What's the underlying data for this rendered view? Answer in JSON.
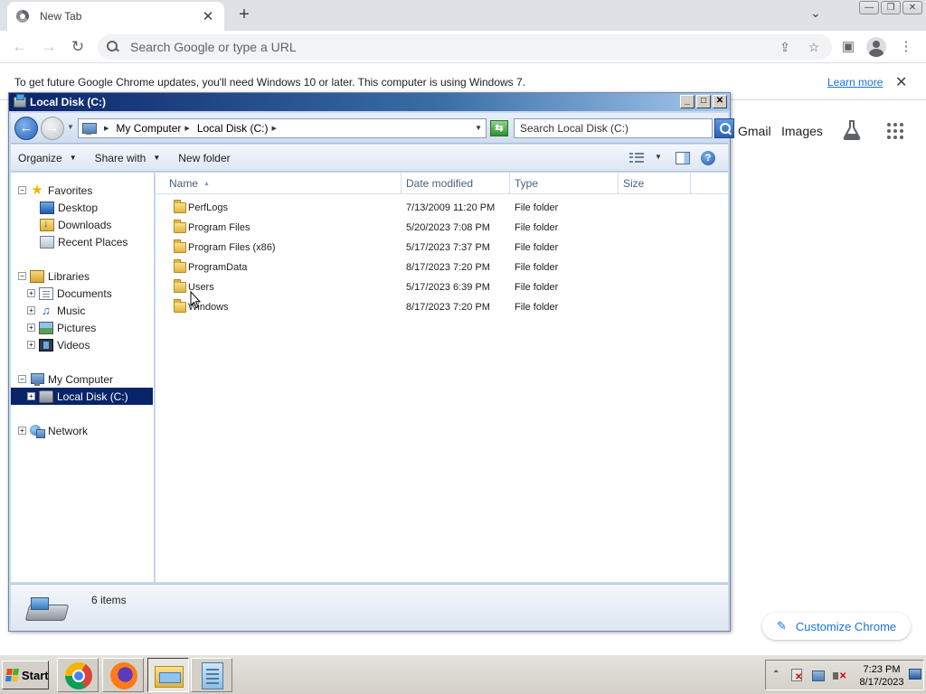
{
  "chrome": {
    "tab_title": "New Tab",
    "omnibox_placeholder": "Search Google or type a URL",
    "infobar_text": "To get future Google Chrome updates, you'll need Windows 10 or later. This computer is using Windows 7.",
    "infobar_link": "Learn more",
    "ntp_links": [
      "Gmail",
      "Images"
    ],
    "customize_label": "Customize Chrome",
    "accent_color": "#1a73e8"
  },
  "explorer": {
    "title": "Local Disk (C:)",
    "breadcrumb": [
      "My Computer",
      "Local Disk (C:)"
    ],
    "search_placeholder": "Search Local Disk (C:)",
    "commands": [
      "Organize",
      "Share with",
      "New folder"
    ],
    "nav": {
      "favorites": "Favorites",
      "favorites_items": [
        "Desktop",
        "Downloads",
        "Recent Places"
      ],
      "libraries": "Libraries",
      "libraries_items": [
        "Documents",
        "Music",
        "Pictures",
        "Videos"
      ],
      "computer": "My Computer",
      "computer_items": [
        "Local Disk (C:)"
      ],
      "network": "Network"
    },
    "columns": [
      "Name",
      "Date modified",
      "Type",
      "Size"
    ],
    "files": [
      {
        "name": "PerfLogs",
        "date": "7/13/2009 11:20 PM",
        "type": "File folder"
      },
      {
        "name": "Program Files",
        "date": "5/20/2023 7:08 PM",
        "type": "File folder"
      },
      {
        "name": "Program Files (x86)",
        "date": "5/17/2023 7:37 PM",
        "type": "File folder"
      },
      {
        "name": "ProgramData",
        "date": "8/17/2023 7:20 PM",
        "type": "File folder"
      },
      {
        "name": "Users",
        "date": "5/17/2023 6:39 PM",
        "type": "File folder"
      },
      {
        "name": "Windows",
        "date": "8/17/2023 7:20 PM",
        "type": "File folder"
      }
    ],
    "status": "6 items"
  },
  "taskbar": {
    "start_label": "Start",
    "time": "7:23 PM",
    "date": "8/17/2023"
  }
}
